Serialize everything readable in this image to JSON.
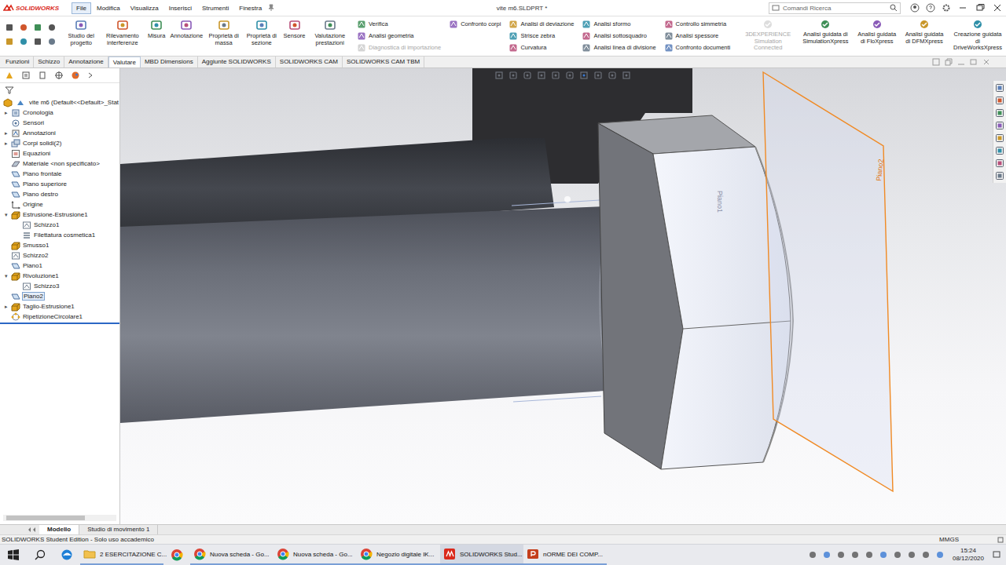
{
  "app": {
    "logo": "SOLIDWORKS",
    "title": "vite m6.SLDPRT *"
  },
  "menu": [
    {
      "label": "File",
      "selected": true
    },
    {
      "label": "Modifica",
      "selected": false
    },
    {
      "label": "Visualizza",
      "selected": false
    },
    {
      "label": "Inserisci",
      "selected": false
    },
    {
      "label": "Strumenti",
      "selected": false
    },
    {
      "label": "Finestra",
      "selected": false
    }
  ],
  "search": {
    "placeholder": "Comandi Ricerca"
  },
  "ribbon": {
    "large": [
      {
        "label": "Studio del progetto",
        "disabled": false
      },
      {
        "label": "Rilevamento interferenze",
        "disabled": false
      },
      {
        "label": "Misura",
        "disabled": false
      },
      {
        "label": "Annotazione",
        "disabled": false
      },
      {
        "label": "Proprietà di massa",
        "disabled": false
      },
      {
        "label": "Proprietà di sezione",
        "disabled": false
      },
      {
        "label": "Sensore",
        "disabled": false
      },
      {
        "label": "Valutazione prestazioni",
        "disabled": false
      }
    ],
    "columns": [
      [
        {
          "label": "Verifica",
          "disabled": false
        },
        {
          "label": "Analisi geometria",
          "disabled": false
        },
        {
          "label": "Diagnostica di importazione",
          "disabled": true
        }
      ],
      [
        {
          "label": "Confronto corpi",
          "disabled": false
        }
      ],
      [
        {
          "label": "Analisi di deviazione",
          "disabled": false
        },
        {
          "label": "Strisce zebra",
          "disabled": false
        },
        {
          "label": "Curvatura",
          "disabled": false
        }
      ],
      [
        {
          "label": "Analisi sformo",
          "disabled": false
        },
        {
          "label": "Analisi sottosquadro",
          "disabled": false
        },
        {
          "label": "Analisi linea di divisione",
          "disabled": false
        }
      ],
      [
        {
          "label": "Controllo simmetria",
          "disabled": false
        },
        {
          "label": "Analisi spessore",
          "disabled": false
        },
        {
          "label": "Confronto documenti",
          "disabled": false
        }
      ]
    ],
    "xpress": [
      {
        "label": "3DEXPERIENCE Simulation Connected",
        "disabled": true
      },
      {
        "label": "Analisi guidata di SimulationXpress",
        "disabled": false
      },
      {
        "label": "Analisi guidata di FloXpress",
        "disabled": false
      },
      {
        "label": "Analisi guidata di DFMXpress",
        "disabled": false
      },
      {
        "label": "Creazione guidata di DriveWorksXpress",
        "disabled": false
      }
    ]
  },
  "tabs": [
    {
      "label": "Funzioni",
      "selected": false
    },
    {
      "label": "Schizzo",
      "selected": false
    },
    {
      "label": "Annotazione",
      "selected": false
    },
    {
      "label": "Valutare",
      "selected": true
    },
    {
      "label": "MBD Dimensions",
      "selected": false
    },
    {
      "label": "Aggiunte SOLIDWORKS",
      "selected": false
    },
    {
      "label": "SOLIDWORKS CAM",
      "selected": false
    },
    {
      "label": "SOLIDWORKS CAM TBM",
      "selected": false
    }
  ],
  "tree": {
    "root": "vite m6  (Default<<Default>_Stat",
    "items": [
      {
        "label": "Cronologia",
        "level": 0,
        "arrow": "▸",
        "kind": "history",
        "selected": false
      },
      {
        "label": "Sensori",
        "level": 0,
        "arrow": "",
        "kind": "sensor",
        "selected": false
      },
      {
        "label": "Annotazioni",
        "level": 0,
        "arrow": "▸",
        "kind": "annotation",
        "selected": false
      },
      {
        "label": "Corpi solidi(2)",
        "level": 0,
        "arrow": "▸",
        "kind": "bodies",
        "selected": false
      },
      {
        "label": "Equazioni",
        "level": 0,
        "arrow": "",
        "kind": "equation",
        "selected": false
      },
      {
        "label": "Materiale <non specificato>",
        "level": 0,
        "arrow": "",
        "kind": "material",
        "selected": false
      },
      {
        "label": "Piano frontale",
        "level": 0,
        "arrow": "",
        "kind": "plane",
        "selected": false
      },
      {
        "label": "Piano superiore",
        "level": 0,
        "arrow": "",
        "kind": "plane",
        "selected": false
      },
      {
        "label": "Piano destro",
        "level": 0,
        "arrow": "",
        "kind": "plane",
        "selected": false
      },
      {
        "label": "Origine",
        "level": 0,
        "arrow": "",
        "kind": "origin",
        "selected": false
      },
      {
        "label": "Estrusione-Estrusione1",
        "level": 0,
        "arrow": "▾",
        "kind": "feature",
        "selected": false
      },
      {
        "label": "Schizzo1",
        "level": 1,
        "arrow": "",
        "kind": "sketch",
        "selected": false
      },
      {
        "label": "Filettatura cosmetica1",
        "level": 1,
        "arrow": "",
        "kind": "thread",
        "selected": false
      },
      {
        "label": "Smusso1",
        "level": 0,
        "arrow": "",
        "kind": "feature",
        "selected": false
      },
      {
        "label": "Schizzo2",
        "level": 0,
        "arrow": "",
        "kind": "sketch",
        "selected": false
      },
      {
        "label": "Piano1",
        "level": 0,
        "arrow": "",
        "kind": "plane",
        "selected": false
      },
      {
        "label": "Rivoluzione1",
        "level": 0,
        "arrow": "▾",
        "kind": "feature",
        "selected": false
      },
      {
        "label": "Schizzo3",
        "level": 1,
        "arrow": "",
        "kind": "sketch",
        "selected": false
      },
      {
        "label": "Piano2",
        "level": 0,
        "arrow": "",
        "kind": "plane",
        "selected": true
      },
      {
        "label": "Taglio-Estrusione1",
        "level": 0,
        "arrow": "▸",
        "kind": "feature",
        "selected": false
      },
      {
        "label": "RipetizioneCircolare1",
        "level": 0,
        "arrow": "",
        "kind": "pattern",
        "selected": false
      }
    ]
  },
  "viewport": {
    "planes": [
      {
        "label": "Piano1",
        "selected": false
      },
      {
        "label": "Piano2",
        "selected": true
      }
    ]
  },
  "bottom_tabs": [
    {
      "label": "Modello",
      "selected": true
    },
    {
      "label": "Studio di movimento 1",
      "selected": false
    }
  ],
  "status_bar": {
    "left": "SOLIDWORKS Student Edition - Solo uso accademico",
    "units": "MMGS"
  },
  "taskbar": {
    "apps": [
      {
        "label": "2 ESERCITAZIONE C...",
        "kind": "folder",
        "selected": false
      },
      {
        "label": "Nuova scheda - Go...",
        "kind": "chrome",
        "selected": false
      },
      {
        "label": "Nuova scheda - Go...",
        "kind": "chrome",
        "selected": false
      },
      {
        "label": "Negozio digitale IK...",
        "kind": "chrome",
        "selected": false
      },
      {
        "label": "SOLIDWORKS Stud...",
        "kind": "solidworks",
        "selected": true
      },
      {
        "label": "nORME DEI COMP...",
        "kind": "powerpoint",
        "selected": false
      }
    ],
    "time": "15:24",
    "date": "08/12/2020"
  }
}
